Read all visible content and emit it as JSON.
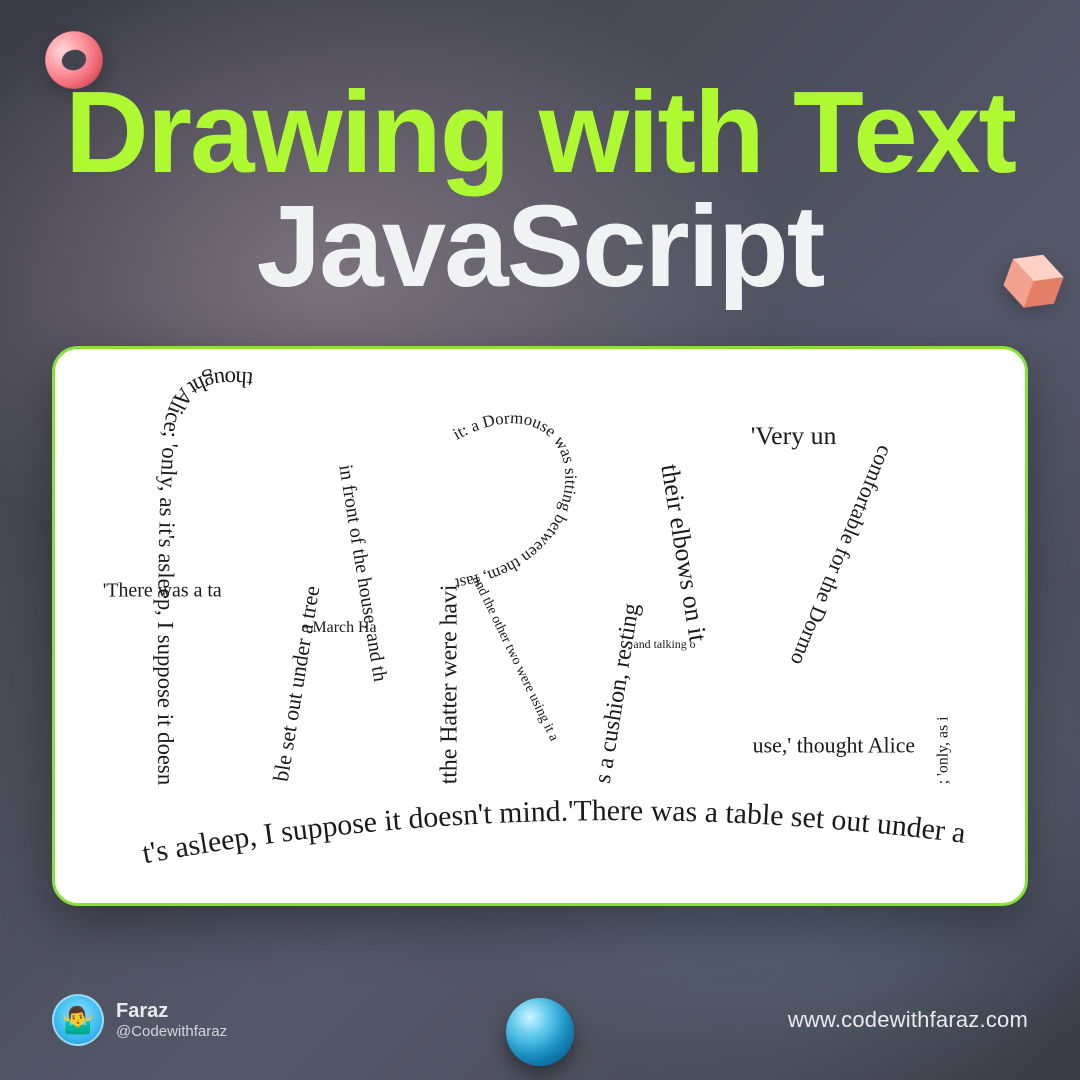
{
  "headline": {
    "line1": "Drawing with Text",
    "line2": "JavaScript"
  },
  "card": {
    "accent": "#86e23a",
    "paths": {
      "f_stem": "thought Alice; 'only, as it's asleep, I suppose it doesn't mi",
      "f_bar": "'There was a ta",
      "a1_left": "ble set out under a tree",
      "a1_right": "in front of the house, and th",
      "a1_bar": "e March Ha",
      "r_stem": "tthe Hatter were havi",
      "r_bowl": "it: a Dormouse was sitting between them, fast a",
      "r_leg": "and the other two were using it a",
      "a2_left": "s a cushion, resting",
      "a2_right": "their elbows on it",
      "a2_bar": ", and talking o",
      "z_top": "'Very un",
      "z_diag": "comfortable for the Dormo",
      "z_bot": "use,' thought Alice",
      "z_side": "; 'only, as i",
      "under": "t's asleep, I suppose it doesn't mind.'There was a table set out under a tree in front of th"
    }
  },
  "footer": {
    "avatar_emoji": "🤷‍♂️",
    "name": "Faraz",
    "handle": "@Codewithfaraz",
    "url": "www.codewithfaraz.com"
  },
  "colors": {
    "lime": "#AEF932",
    "white": "#F1F2F3",
    "card_border": "#86e23a"
  }
}
